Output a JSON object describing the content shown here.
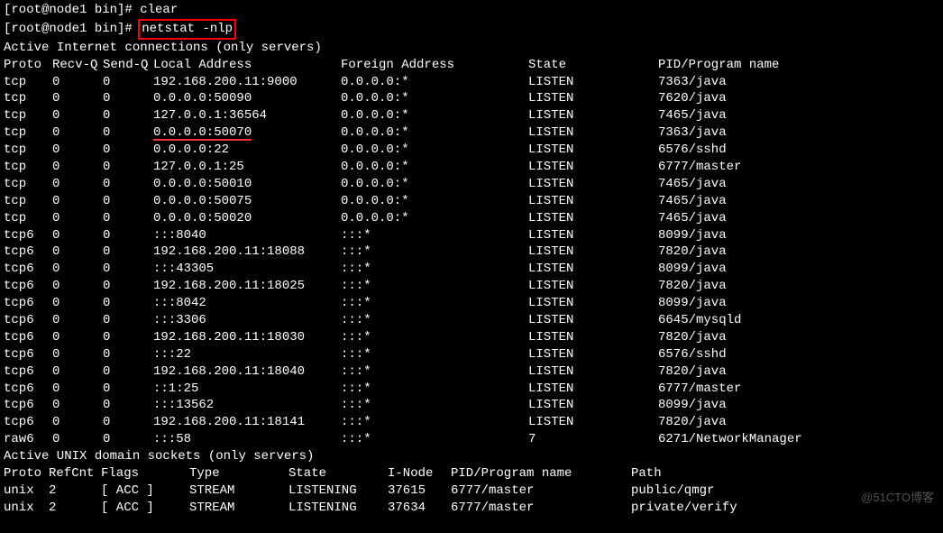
{
  "prev_line": "[root@node1 bin]# clear",
  "prompt": "[root@node1 bin]# ",
  "command": "netstat -nlp",
  "header1": "Active Internet connections (only servers)",
  "columns": {
    "proto": "Proto",
    "recvq": "Recv-Q",
    "sendq": "Send-Q",
    "local": "Local Address",
    "foreign": "Foreign Address",
    "state": "State",
    "pid": "PID/Program name"
  },
  "underlined_local": "0.0.0.0:50070",
  "rows": [
    {
      "proto": "tcp",
      "recvq": "0",
      "sendq": "0",
      "local": "192.168.200.11:9000",
      "foreign": "0.0.0.0:*",
      "state": "LISTEN",
      "pid": "7363/java"
    },
    {
      "proto": "tcp",
      "recvq": "0",
      "sendq": "0",
      "local": "0.0.0.0:50090",
      "foreign": "0.0.0.0:*",
      "state": "LISTEN",
      "pid": "7620/java"
    },
    {
      "proto": "tcp",
      "recvq": "0",
      "sendq": "0",
      "local": "127.0.0.1:36564",
      "foreign": "0.0.0.0:*",
      "state": "LISTEN",
      "pid": "7465/java"
    },
    {
      "proto": "tcp",
      "recvq": "0",
      "sendq": "0",
      "local": "0.0.0.0:50070",
      "foreign": "0.0.0.0:*",
      "state": "LISTEN",
      "pid": "7363/java",
      "underline": true
    },
    {
      "proto": "tcp",
      "recvq": "0",
      "sendq": "0",
      "local": "0.0.0.0:22",
      "foreign": "0.0.0.0:*",
      "state": "LISTEN",
      "pid": "6576/sshd"
    },
    {
      "proto": "tcp",
      "recvq": "0",
      "sendq": "0",
      "local": "127.0.0.1:25",
      "foreign": "0.0.0.0:*",
      "state": "LISTEN",
      "pid": "6777/master"
    },
    {
      "proto": "tcp",
      "recvq": "0",
      "sendq": "0",
      "local": "0.0.0.0:50010",
      "foreign": "0.0.0.0:*",
      "state": "LISTEN",
      "pid": "7465/java"
    },
    {
      "proto": "tcp",
      "recvq": "0",
      "sendq": "0",
      "local": "0.0.0.0:50075",
      "foreign": "0.0.0.0:*",
      "state": "LISTEN",
      "pid": "7465/java"
    },
    {
      "proto": "tcp",
      "recvq": "0",
      "sendq": "0",
      "local": "0.0.0.0:50020",
      "foreign": "0.0.0.0:*",
      "state": "LISTEN",
      "pid": "7465/java"
    },
    {
      "proto": "tcp6",
      "recvq": "0",
      "sendq": "0",
      "local": ":::8040",
      "foreign": ":::*",
      "state": "LISTEN",
      "pid": "8099/java"
    },
    {
      "proto": "tcp6",
      "recvq": "0",
      "sendq": "0",
      "local": "192.168.200.11:18088",
      "foreign": ":::*",
      "state": "LISTEN",
      "pid": "7820/java"
    },
    {
      "proto": "tcp6",
      "recvq": "0",
      "sendq": "0",
      "local": ":::43305",
      "foreign": ":::*",
      "state": "LISTEN",
      "pid": "8099/java"
    },
    {
      "proto": "tcp6",
      "recvq": "0",
      "sendq": "0",
      "local": "192.168.200.11:18025",
      "foreign": ":::*",
      "state": "LISTEN",
      "pid": "7820/java"
    },
    {
      "proto": "tcp6",
      "recvq": "0",
      "sendq": "0",
      "local": ":::8042",
      "foreign": ":::*",
      "state": "LISTEN",
      "pid": "8099/java"
    },
    {
      "proto": "tcp6",
      "recvq": "0",
      "sendq": "0",
      "local": ":::3306",
      "foreign": ":::*",
      "state": "LISTEN",
      "pid": "6645/mysqld"
    },
    {
      "proto": "tcp6",
      "recvq": "0",
      "sendq": "0",
      "local": "192.168.200.11:18030",
      "foreign": ":::*",
      "state": "LISTEN",
      "pid": "7820/java"
    },
    {
      "proto": "tcp6",
      "recvq": "0",
      "sendq": "0",
      "local": ":::22",
      "foreign": ":::*",
      "state": "LISTEN",
      "pid": "6576/sshd"
    },
    {
      "proto": "tcp6",
      "recvq": "0",
      "sendq": "0",
      "local": "192.168.200.11:18040",
      "foreign": ":::*",
      "state": "LISTEN",
      "pid": "7820/java"
    },
    {
      "proto": "tcp6",
      "recvq": "0",
      "sendq": "0",
      "local": "::1:25",
      "foreign": ":::*",
      "state": "LISTEN",
      "pid": "6777/master"
    },
    {
      "proto": "tcp6",
      "recvq": "0",
      "sendq": "0",
      "local": ":::13562",
      "foreign": ":::*",
      "state": "LISTEN",
      "pid": "8099/java"
    },
    {
      "proto": "tcp6",
      "recvq": "0",
      "sendq": "0",
      "local": "192.168.200.11:18141",
      "foreign": ":::*",
      "state": "LISTEN",
      "pid": "7820/java"
    },
    {
      "proto": "raw6",
      "recvq": "0",
      "sendq": "0",
      "local": ":::58",
      "foreign": ":::*",
      "state": "7",
      "pid": "6271/NetworkManager"
    }
  ],
  "header2": "Active UNIX domain sockets (only servers)",
  "columns2": {
    "proto": "Proto",
    "refcnt": "RefCnt",
    "flags": "Flags",
    "type": "Type",
    "state": "State",
    "inode": "I-Node",
    "pid": "PID/Program name",
    "path": "Path"
  },
  "unix_rows": [
    {
      "proto": "unix",
      "refcnt": "2",
      "flags": "[ ACC ]",
      "type": "STREAM",
      "state": "LISTENING",
      "inode": "37615",
      "pid": "6777/master",
      "path": "public/qmgr"
    },
    {
      "proto": "unix",
      "refcnt": "2",
      "flags": "[ ACC ]",
      "type": "STREAM",
      "state": "LISTENING",
      "inode": "37634",
      "pid": "6777/master",
      "path": "private/verify"
    }
  ],
  "watermark": "@51CTO博客"
}
